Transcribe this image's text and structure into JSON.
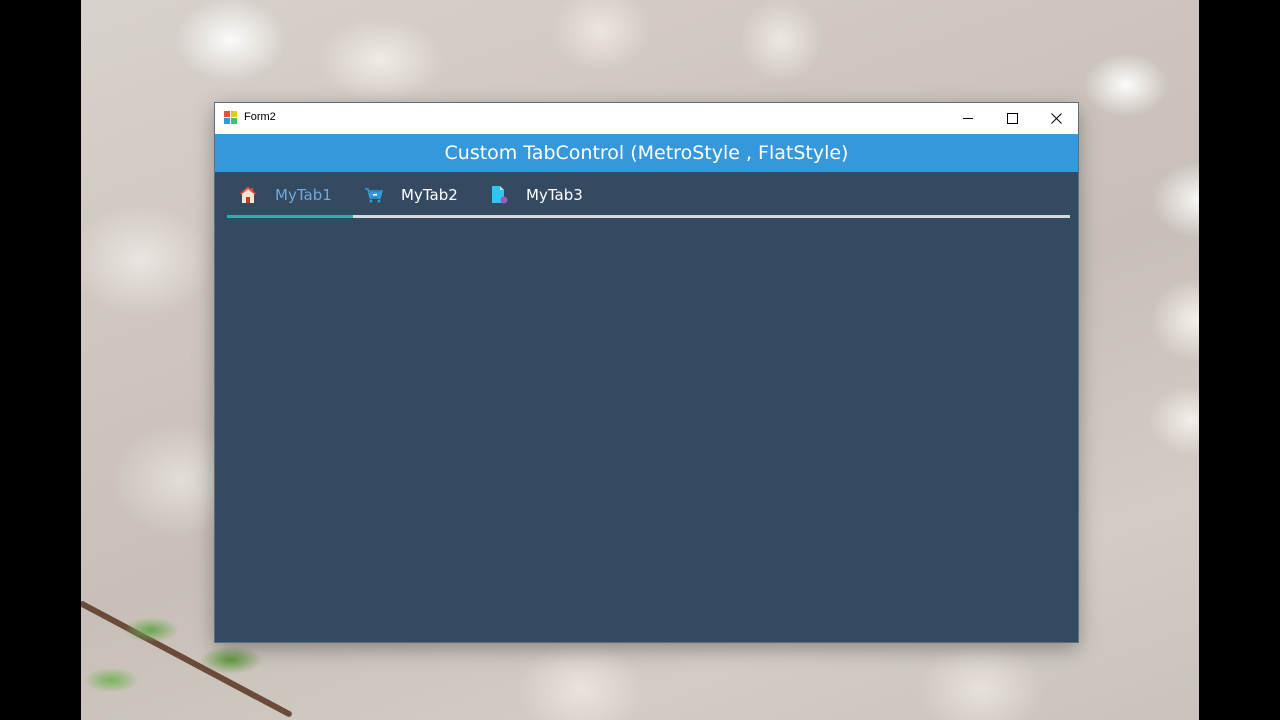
{
  "window": {
    "title": "Form2",
    "header_text": "Custom TabControl  (MetroStyle , FlatStyle)"
  },
  "tabs": [
    {
      "label": "MyTab1",
      "icon": "home-icon",
      "active": true
    },
    {
      "label": "MyTab2",
      "icon": "cart-icon",
      "active": false
    },
    {
      "label": "MyTab3",
      "icon": "document-icon",
      "active": false
    }
  ],
  "colors": {
    "header_bar": "#3498db",
    "content_bg": "#344a61",
    "active_tab_text": "#6fa8dc",
    "active_tab_indicator": "#1fb5ac",
    "tab_underline": "#d5d9dd"
  }
}
